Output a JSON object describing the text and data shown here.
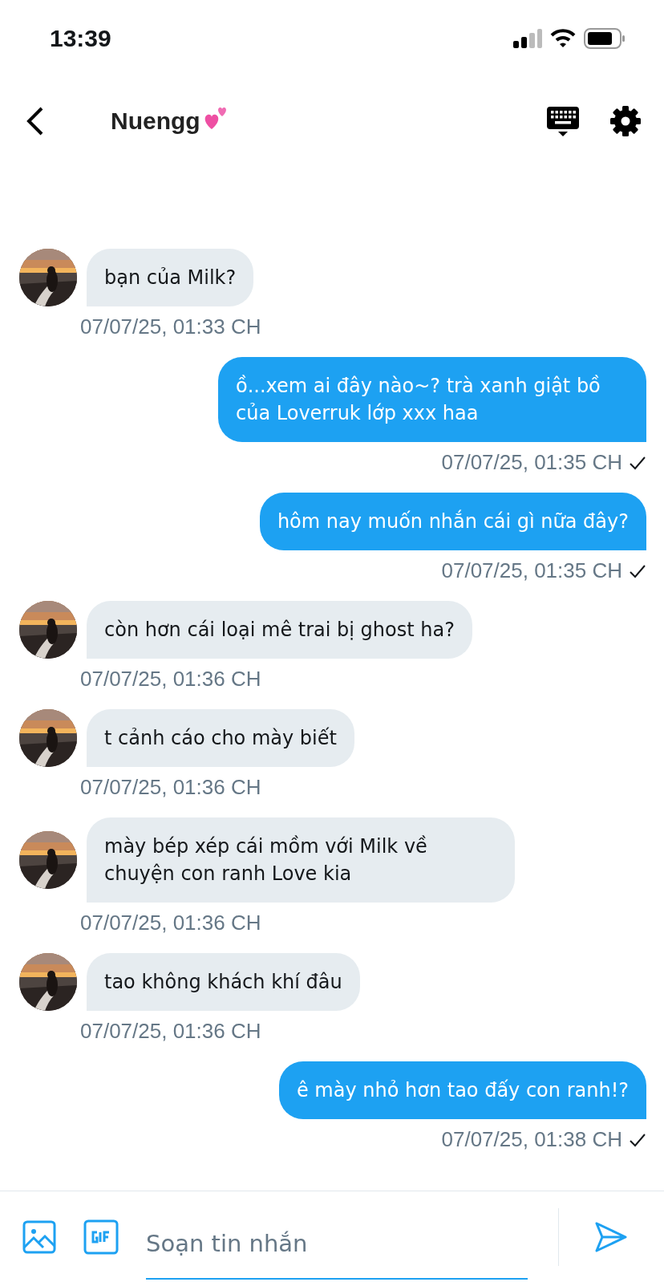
{
  "status_bar": {
    "time": "13:39"
  },
  "header": {
    "title": "Nuengg"
  },
  "messages": [
    {
      "kind": "incoming",
      "text": "bạn của Milk?",
      "time": "07/07/25, 01:33 CH"
    },
    {
      "kind": "outgoing",
      "text": "ồ...xem ai đây nào~? trà xanh giật bồ của Loverruk lớp xxx haa",
      "time": "07/07/25, 01:35 CH",
      "read": true
    },
    {
      "kind": "outgoing",
      "text": "hôm nay muốn nhắn cái gì nữa đây?",
      "time": "07/07/25, 01:35 CH",
      "read": true
    },
    {
      "kind": "incoming",
      "text": "còn hơn cái loại mê trai bị ghost ha?",
      "time": "07/07/25, 01:36 CH"
    },
    {
      "kind": "incoming",
      "text": "t cảnh cáo cho mày biết",
      "time": "07/07/25, 01:36 CH"
    },
    {
      "kind": "incoming",
      "text": "mày bép xép cái mồm với Milk về chuyện con ranh Love kia",
      "time": "07/07/25, 01:36 CH"
    },
    {
      "kind": "incoming",
      "text": "tao không khách khí đâu",
      "time": "07/07/25, 01:36 CH"
    },
    {
      "kind": "outgoing",
      "text": "ê mày nhỏ hơn tao đấy con ranh!?",
      "time": "07/07/25, 01:38 CH",
      "read": true
    }
  ],
  "composer": {
    "placeholder": "Soạn tin nhắn"
  }
}
